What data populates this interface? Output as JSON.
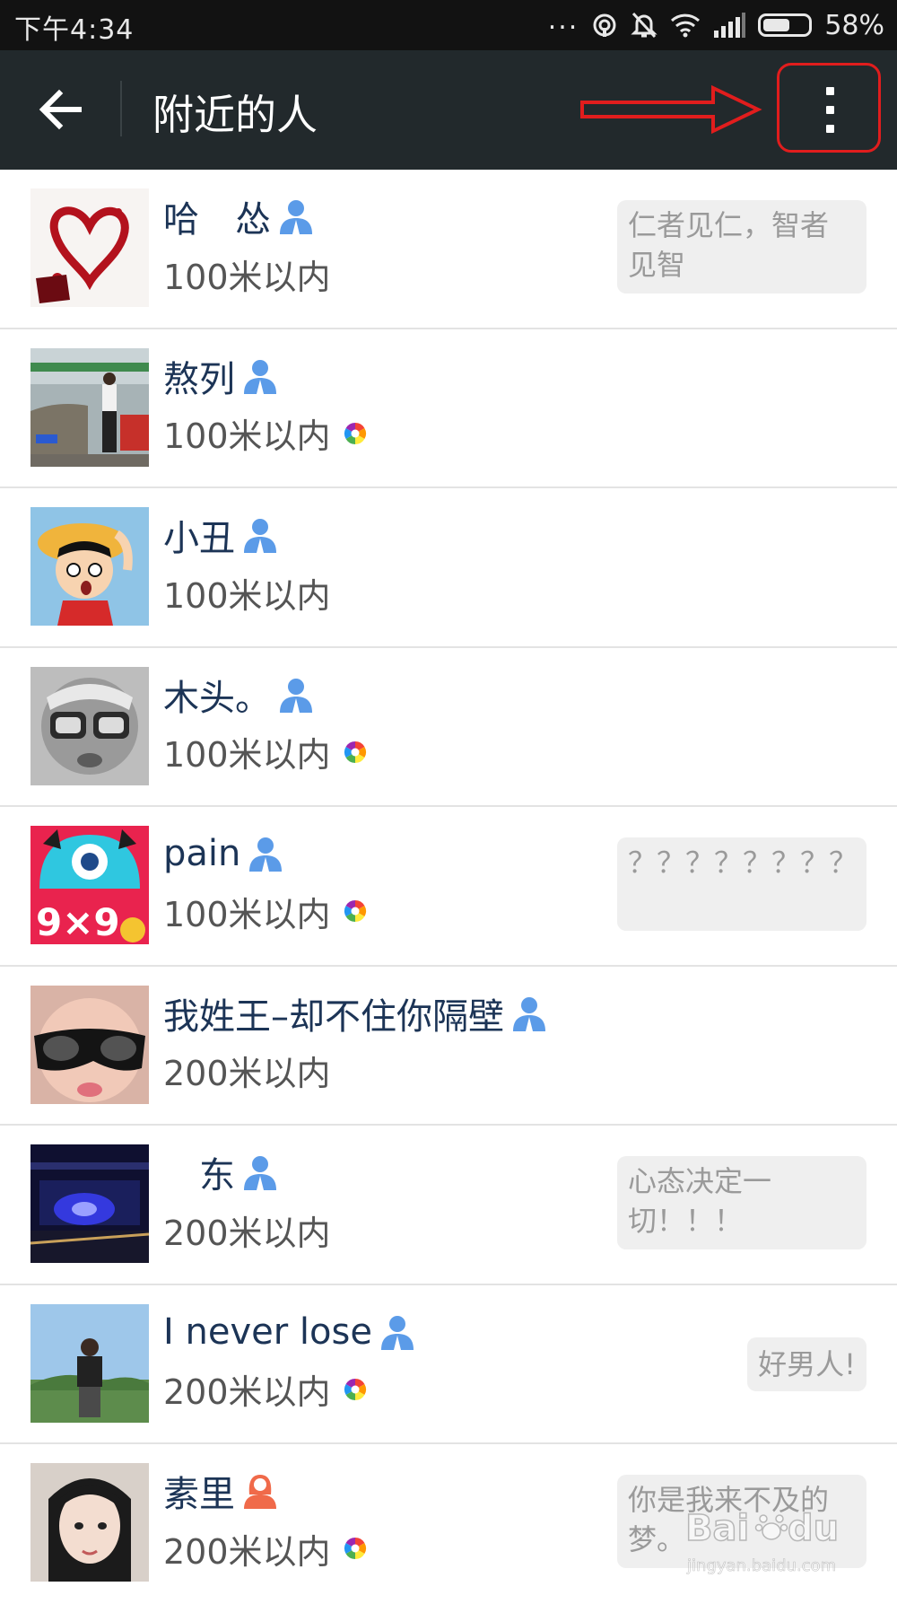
{
  "status_bar": {
    "time": "下午4:34",
    "more": "...",
    "battery": "58%",
    "battery_level": 0.58
  },
  "app_bar": {
    "title": "附近的人"
  },
  "people": [
    {
      "name": "哈　怂",
      "gender": "male",
      "distance": "100米以内",
      "has_moments": false,
      "signature": "仁者见仁，智者见智"
    },
    {
      "name": "熬列",
      "gender": "male",
      "distance": "100米以内",
      "has_moments": true,
      "signature": ""
    },
    {
      "name": "小丑",
      "gender": "male",
      "distance": "100米以内",
      "has_moments": false,
      "signature": ""
    },
    {
      "name": "木头。",
      "gender": "male",
      "distance": "100米以内",
      "has_moments": true,
      "signature": ""
    },
    {
      "name": "pain",
      "gender": "male",
      "distance": "100米以内",
      "has_moments": true,
      "signature": "？？？？？？？？"
    },
    {
      "name": "我姓王–却不住你隔壁",
      "gender": "male",
      "distance": "200米以内",
      "has_moments": false,
      "signature": ""
    },
    {
      "name": "　东",
      "gender": "male",
      "distance": "200米以内",
      "has_moments": false,
      "signature": "心态决定一切！！！"
    },
    {
      "name": "I never lose",
      "gender": "male",
      "distance": "200米以内",
      "has_moments": true,
      "signature": "好男人!"
    },
    {
      "name": "素里",
      "gender": "female",
      "distance": "200米以内",
      "has_moments": true,
      "signature": "你是我来不及的梦。"
    }
  ],
  "colors": {
    "male_icon": "#5b9be8",
    "female_icon": "#f06a4a",
    "annotation": "#e11d1d",
    "app_bar": "#22292c"
  },
  "watermark": {
    "brand": "Bai du 经验",
    "url": "jingyan.baidu.com"
  }
}
